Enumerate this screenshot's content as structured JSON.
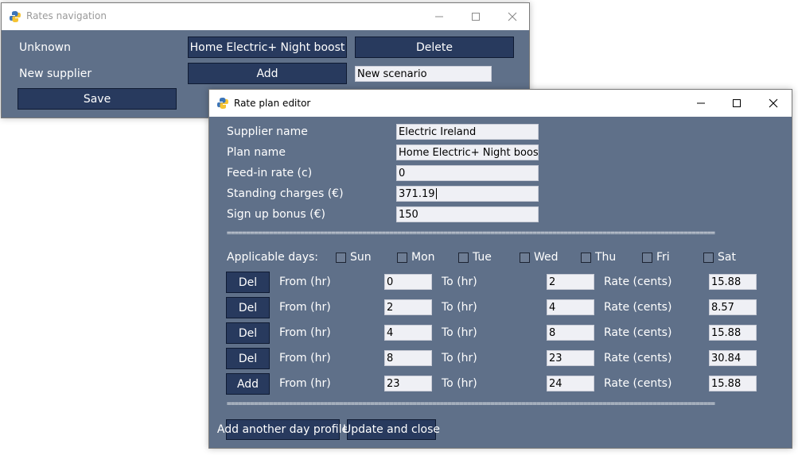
{
  "nav_window": {
    "title": "Rates navigation",
    "rows": [
      {
        "label": "Unknown",
        "button": "Home Electric+ Night boost",
        "action": "Delete"
      },
      {
        "label": "New supplier",
        "button": "Add",
        "field": "New scenario"
      }
    ],
    "save_label": "Save"
  },
  "editor_window": {
    "title": "Rate plan editor",
    "fields": [
      {
        "label": "Supplier name",
        "value": "Electric Ireland"
      },
      {
        "label": "Plan name",
        "value": "Home Electric+ Night boost"
      },
      {
        "label": "Feed-in rate (c)",
        "value": "0"
      },
      {
        "label": "Standing charges (€)",
        "value": "371.19"
      },
      {
        "label": "Sign up bonus (€)",
        "value": "150"
      }
    ],
    "separator": "==============================================================================================================================",
    "applicable_days_label": "Applicable days:",
    "days": [
      "Sun",
      "Mon",
      "Tue",
      "Wed",
      "Thu",
      "Fri",
      "Sat"
    ],
    "from_label": "From (hr)",
    "to_label": "To (hr)",
    "rate_label": "Rate (cents)",
    "rate_rows": [
      {
        "button": "Del",
        "from": "0",
        "to": "2",
        "rate": "15.88"
      },
      {
        "button": "Del",
        "from": "2",
        "to": "4",
        "rate": "8.57"
      },
      {
        "button": "Del",
        "from": "4",
        "to": "8",
        "rate": "15.88"
      },
      {
        "button": "Del",
        "from": "8",
        "to": "23",
        "rate": "30.84"
      },
      {
        "button": "Add",
        "from": "23",
        "to": "24",
        "rate": "15.88"
      }
    ],
    "add_profile_label": "Add another day profile",
    "update_close_label": "Update and close"
  }
}
